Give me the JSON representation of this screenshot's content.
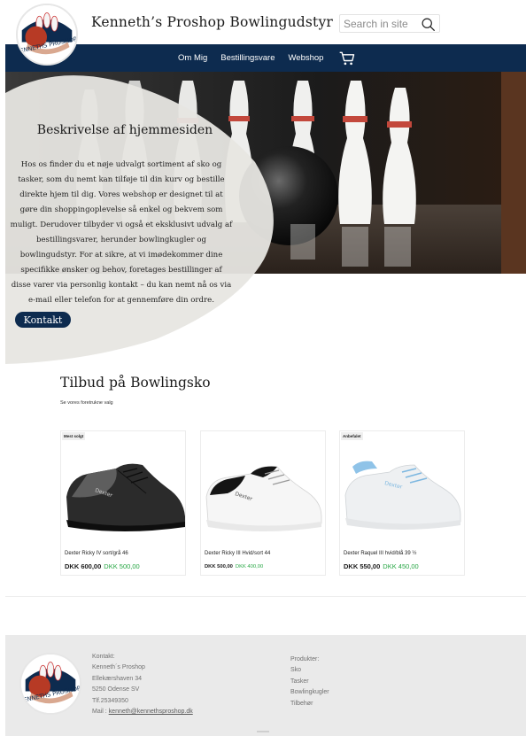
{
  "header": {
    "logo_text": "KENNETHS PROSHOP",
    "title": "Kenneth’s Proshop Bowlingudstyr",
    "search_placeholder": "Search in site",
    "search_icon": "search-icon"
  },
  "nav": {
    "items": [
      {
        "label": "Om Mig"
      },
      {
        "label": "Bestillingsvare"
      },
      {
        "label": "Webshop"
      }
    ],
    "cart_icon": "cart-icon",
    "background": "#0d2b4f"
  },
  "hero": {
    "title": "Beskrivelse af hjemmesiden",
    "text": "Hos os finder du et nøje udvalgt sortiment af sko og tasker, som du nemt kan tilføje til din kurv og bestille direkte hjem til dig. Vores webshop er designet til at gøre din shoppingoplevelse så enkel og bekvem som muligt. Derudover tilbyder vi også et eksklusivt udvalg af bestillingsvarer, herunder bowlingkugler og bowlingudstyr. For at sikre, at vi imødekommer dine specifikke ønsker og behov, foretages bestillinger af disse varer via personlig kontakt – du kan nemt nå os via e-mail eller telefon for at gennemføre din ordre.",
    "button_label": "Kontakt"
  },
  "offers": {
    "title": "Tilbud på Bowlingsko",
    "subtitle": "Se vores foretrukne valg",
    "products": [
      {
        "badge": "Mest solgt",
        "name": "Dexter Ricky IV sort/grå 46",
        "old_price": "DKK 600,00",
        "new_price": "DKK 500,00",
        "shoe_color": "black"
      },
      {
        "badge": "",
        "name": "Dexter Ricky III Hvid/sort 44",
        "old_price": "DKK 500,00",
        "new_price": "DKK 400,00",
        "shoe_color": "white-black"
      },
      {
        "badge": "Anbefalet",
        "name": "Dexter Raquel III hvid/blå 39 ½",
        "old_price": "DKK 550,00",
        "new_price": "DKK 450,00",
        "shoe_color": "white-blue"
      }
    ],
    "price_green": "#28a745"
  },
  "footer": {
    "contact": {
      "heading": "Kontakt:",
      "name": "Kenneth´s Proshop",
      "street": "Ellekærshaven 34",
      "city": "5250  Odense SV",
      "phone": "Tlf.25349350",
      "mail_label": "Mail : ",
      "mail": "kenneth@kennethsproshop.dk"
    },
    "products": {
      "heading": "Produkter:",
      "items": [
        "Sko",
        "Tasker",
        "Bowlingkugler",
        "Tilbehør"
      ]
    }
  }
}
